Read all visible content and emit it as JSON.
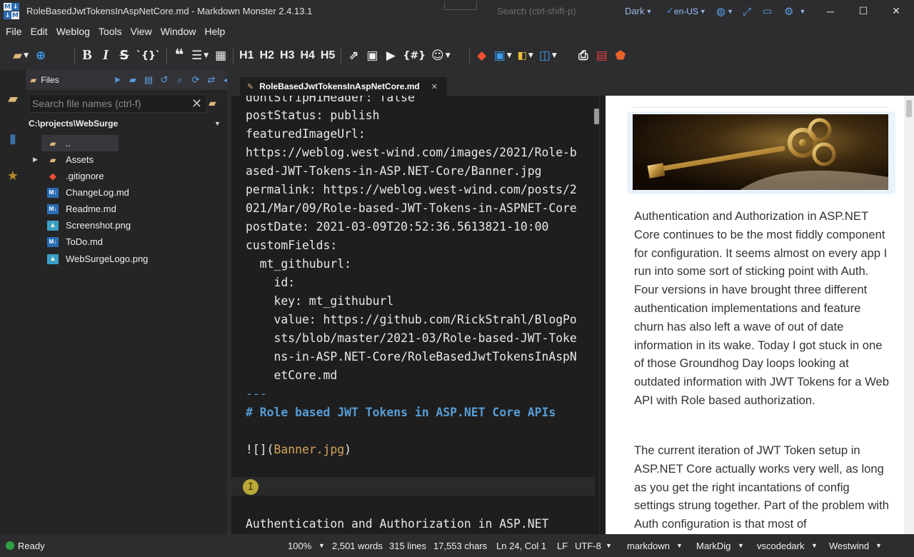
{
  "window": {
    "title": "RoleBasedJwtTokensInAspNetCore.md  - Markdown Monster 2.4.13.1",
    "search_placeholder": "Search (ctrl-shift-p)",
    "theme": "Dark",
    "language": "en-US"
  },
  "menu": [
    "File",
    "Edit",
    "Weblog",
    "Tools",
    "View",
    "Window",
    "Help"
  ],
  "toolbar": {
    "bold": "B",
    "italic": "I",
    "strike": "S",
    "code": "`{}`",
    "h1": "H1",
    "h2": "H2",
    "h3": "H3",
    "h4": "H4",
    "h5": "H5",
    "special": "{#}"
  },
  "files": {
    "title": "Files",
    "search_placeholder": "Search file names (ctrl-f)",
    "folder": "C:\\projects\\WebSurge",
    "items": [
      {
        "name": "..",
        "icon": "folder-icon"
      },
      {
        "name": "Assets",
        "icon": "folder-icon"
      },
      {
        "name": ".gitignore",
        "icon": "git-icon"
      },
      {
        "name": "ChangeLog.md",
        "icon": "markdown-file-icon"
      },
      {
        "name": "Readme.md",
        "icon": "markdown-file-icon"
      },
      {
        "name": "Screenshot.png",
        "icon": "image-file-icon"
      },
      {
        "name": "ToDo.md",
        "icon": "markdown-file-icon"
      },
      {
        "name": "WebSurgeLogo.png",
        "icon": "image-file-icon"
      }
    ]
  },
  "editor": {
    "tab": "RoleBasedJwtTokensInAspNetCore.md",
    "lines": [
      "dontStripH1Header: false",
      "postStatus: publish",
      "featuredImageUrl:",
      "https://weblog.west-wind.com/images/2021/Role-b",
      "ased-JWT-Tokens-in-ASP.NET-Core/Banner.jpg",
      "permalink: https://weblog.west-wind.com/posts/2",
      "021/Mar/09/Role-based-JWT-Tokens-in-ASPNET-Core",
      "postDate: 2021-03-09T20:52:36.5613821-10:00",
      "customFields:",
      "  mt_githuburl:",
      "    id:",
      "    key: mt_githuburl",
      "    value: https://github.com/RickStrahl/BlogPo",
      "    sts/blob/master/2021-03/Role-based-JWT-Toke",
      "    ns-in-ASP.NET-Core/RoleBasedJwtTokensInAspN",
      "    etCore.md",
      "---",
      "# Role based JWT Tokens in ASP.NET Core APIs",
      "",
      "![](Banner.jpg)",
      "",
      "",
      "",
      "Authentication and Authorization in ASP.NET"
    ],
    "img_link_prefix": "![](",
    "img_link_url": "Banner.jpg",
    "img_link_suffix": ")",
    "cursor_glyph": "I"
  },
  "preview": {
    "paragraphs": [
      "Authentication and Authorization in ASP.NET Core continues to be the most fiddly component for configuration. It seems almost on every app I run into some sort of sticking point with Auth. Four versions in have brought three different authentication implementations and feature churn has also left a wave of out of date information in its wake. Today I got stuck in one of those Groundhog Day loops looking at outdated information with JWT Tokens for a Web API with Role based authorization.",
      "The current iteration of JWT Token setup in ASP.NET Core actually works very well, as long as you get the right incantations of config settings strung together. Part of the problem with Auth configuration is that most of"
    ]
  },
  "status": {
    "state": "Ready",
    "zoom": "100%",
    "words": "2,501 words",
    "lines": "315 lines",
    "chars": "17,553 chars",
    "position": "Ln 24, Col 1",
    "line_ending": "LF",
    "encoding": "UTF-8",
    "syntax": "markdown",
    "parser": "MarkDig",
    "editor_theme": "vscodedark",
    "preview_theme": "Westwind"
  }
}
